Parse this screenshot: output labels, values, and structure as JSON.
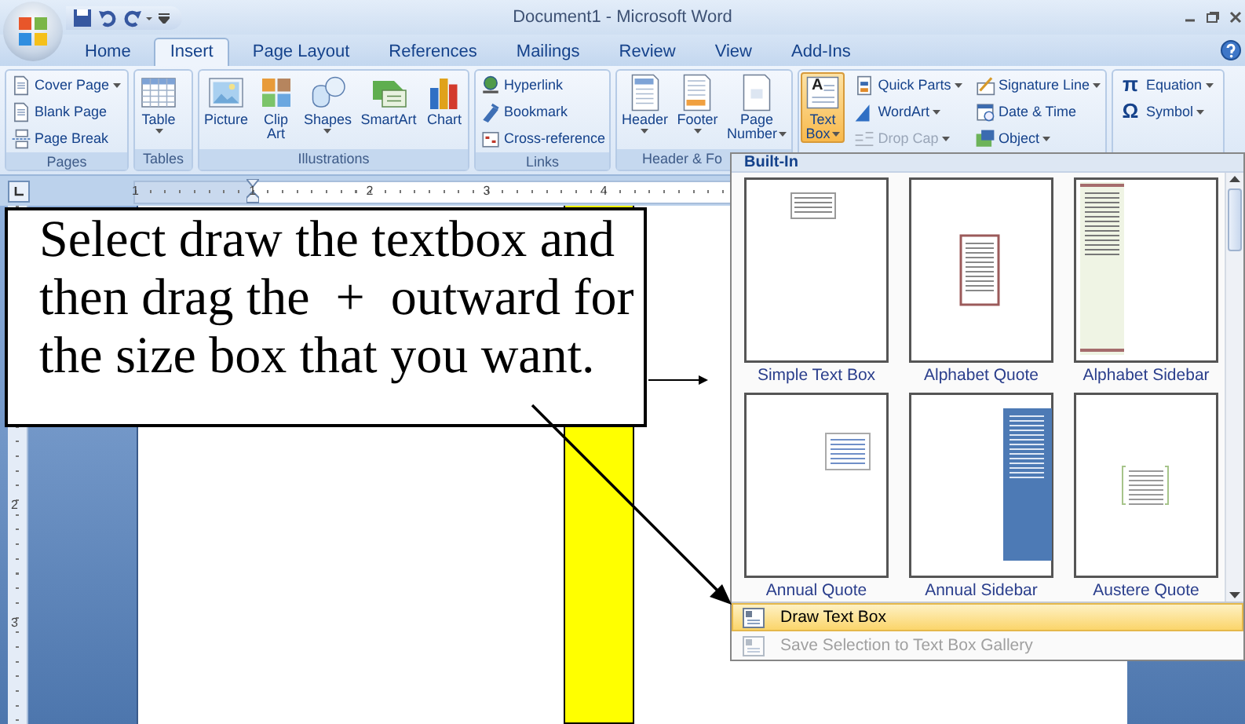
{
  "window": {
    "title": "Document1 - Microsoft Word"
  },
  "tabs": [
    {
      "label": "Home",
      "selected": false
    },
    {
      "label": "Insert",
      "selected": true
    },
    {
      "label": "Page Layout",
      "selected": false
    },
    {
      "label": "References",
      "selected": false
    },
    {
      "label": "Mailings",
      "selected": false
    },
    {
      "label": "Review",
      "selected": false
    },
    {
      "label": "View",
      "selected": false
    },
    {
      "label": "Add-Ins",
      "selected": false
    }
  ],
  "ribbon": {
    "groups": [
      {
        "label": "Pages",
        "columns": [
          [
            {
              "kind": "small",
              "label": "Cover Page",
              "dropdown": true,
              "active": false,
              "disabled": false
            },
            {
              "kind": "small",
              "label": "Blank Page",
              "dropdown": false,
              "active": false,
              "disabled": false
            },
            {
              "kind": "small",
              "label": "Page Break",
              "dropdown": false,
              "active": false,
              "disabled": false
            }
          ]
        ]
      },
      {
        "label": "Tables",
        "columns": [
          [
            {
              "kind": "large",
              "label": "Table",
              "dropdown": true,
              "active": false,
              "disabled": false
            }
          ]
        ]
      },
      {
        "label": "Illustrations",
        "columns": [
          [
            {
              "kind": "large",
              "label": "Picture",
              "dropdown": false,
              "active": false,
              "disabled": false
            }
          ],
          [
            {
              "kind": "large",
              "label": "Clip\nArt",
              "dropdown": false,
              "active": false,
              "disabled": false
            }
          ],
          [
            {
              "kind": "large",
              "label": "Shapes",
              "dropdown": true,
              "active": false,
              "disabled": false
            }
          ],
          [
            {
              "kind": "large",
              "label": "SmartArt",
              "dropdown": false,
              "active": false,
              "disabled": false
            }
          ],
          [
            {
              "kind": "large",
              "label": "Chart",
              "dropdown": false,
              "active": false,
              "disabled": false
            }
          ]
        ]
      },
      {
        "label": "Links",
        "columns": [
          [
            {
              "kind": "small",
              "label": "Hyperlink",
              "dropdown": false,
              "active": false,
              "disabled": false
            },
            {
              "kind": "small",
              "label": "Bookmark",
              "dropdown": false,
              "active": false,
              "disabled": false
            },
            {
              "kind": "small",
              "label": "Cross-reference",
              "dropdown": false,
              "active": false,
              "disabled": false
            }
          ]
        ]
      },
      {
        "label": "Header & Fo",
        "columns": [
          [
            {
              "kind": "large",
              "label": "Header",
              "dropdown": true,
              "active": false,
              "disabled": false
            }
          ],
          [
            {
              "kind": "large",
              "label": "Footer",
              "dropdown": true,
              "active": false,
              "disabled": false
            }
          ],
          [
            {
              "kind": "large",
              "label": "Page\nNumber",
              "dropdown": true,
              "active": false,
              "disabled": false
            }
          ]
        ]
      },
      {
        "columns": [
          [
            {
              "kind": "large",
              "glyph": "A",
              "label": "Text\nBox",
              "dropdown": true,
              "active": true,
              "disabled": false
            }
          ],
          [
            {
              "kind": "small",
              "label": "Quick Parts",
              "dropdown": true,
              "active": false,
              "disabled": false
            },
            {
              "kind": "small",
              "label": "WordArt",
              "dropdown": true,
              "active": false,
              "disabled": false
            },
            {
              "kind": "small",
              "label": "Drop Cap",
              "dropdown": true,
              "active": false,
              "disabled": true
            }
          ],
          [
            {
              "kind": "small",
              "label": "Signature Line",
              "dropdown": true,
              "active": false,
              "disabled": false
            },
            {
              "kind": "small",
              "label": "Date & Time",
              "dropdown": false,
              "active": false,
              "disabled": false
            },
            {
              "kind": "small",
              "label": "Object",
              "dropdown": true,
              "active": false,
              "disabled": false
            }
          ]
        ]
      },
      {
        "columns": [
          [
            {
              "kind": "small",
              "glyph": "π",
              "label": "Equation",
              "dropdown": true,
              "active": false,
              "disabled": false
            },
            {
              "kind": "small",
              "glyph": "Ω",
              "label": "Symbol",
              "dropdown": true,
              "active": false,
              "disabled": false
            }
          ]
        ]
      }
    ]
  },
  "ruler": {
    "horizontal": [
      "1",
      "1",
      "2",
      "3",
      "4"
    ],
    "vertical": [
      "2",
      "3"
    ]
  },
  "callout": {
    "text": "Select draw the textbox and then drag the  +  outward for the size box that you want."
  },
  "gallery": {
    "header": "Built-In",
    "items": [
      {
        "label": "Simple Text Box"
      },
      {
        "label": "Alphabet Quote"
      },
      {
        "label": "Alphabet Sidebar"
      },
      {
        "label": "Annual Quote"
      },
      {
        "label": "Annual Sidebar"
      },
      {
        "label": "Austere Quote"
      }
    ],
    "commands": [
      {
        "label": "Draw Text Box",
        "highlighted": true,
        "disabled": false
      },
      {
        "label": "Save Selection to Text Box Gallery",
        "highlighted": false,
        "disabled": true
      }
    ]
  }
}
